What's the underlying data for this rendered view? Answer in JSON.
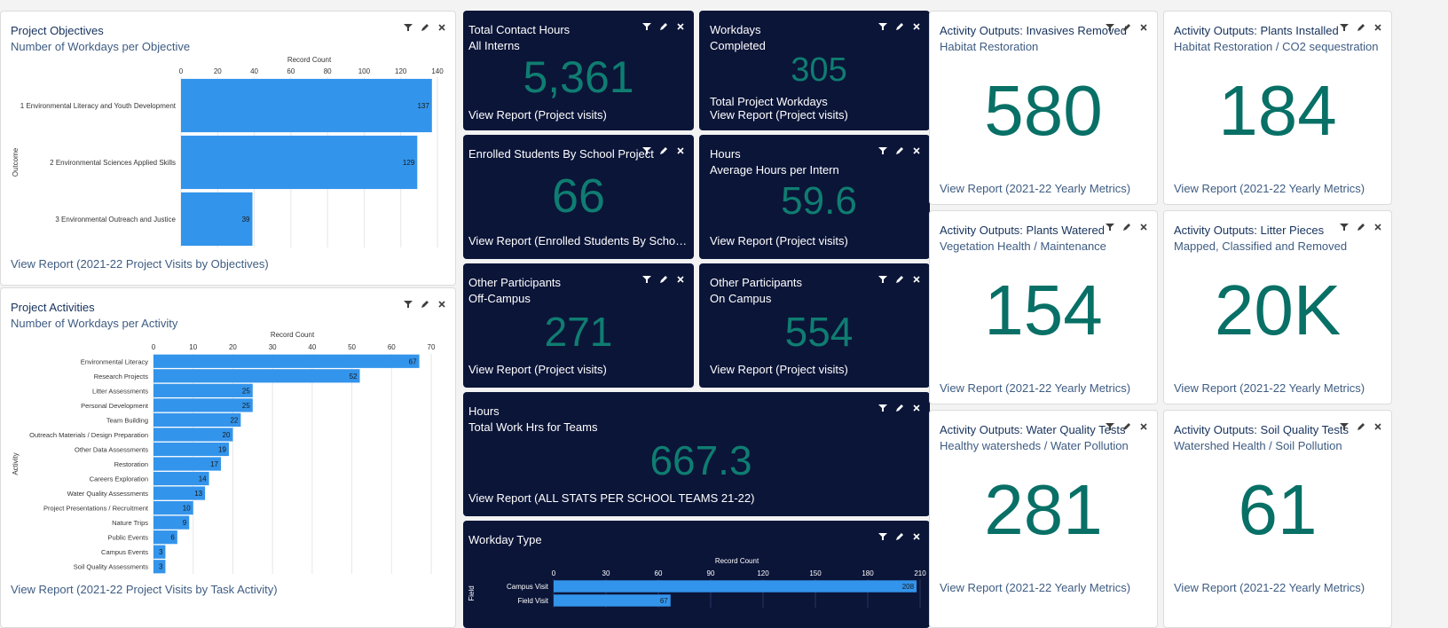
{
  "colors": {
    "accent_teal": "#087066",
    "bar_blue": "#3394eb",
    "dark_panel": "#0b1538",
    "link": "#3e5c82"
  },
  "icons": [
    "filter-icon",
    "pencil-icon",
    "close-icon"
  ],
  "objectives": {
    "title": "Project Objectives",
    "subtitle": "Number of Workdays per Objective",
    "link": "View Report (2021-22 Project Visits by Objectives)",
    "chart_data": {
      "type": "bar",
      "orientation": "horizontal",
      "categories": [
        "1 Environmental Literacy and Youth Development",
        "2 Environmental Sciences Applied Skills",
        "3 Environmental Outreach and Justice"
      ],
      "values": [
        137,
        129,
        39
      ],
      "xlabel": "Record Count",
      "ylabel": "Outcome",
      "xlim": [
        0,
        140
      ],
      "xticks": [
        "0",
        "20",
        "40",
        "60",
        "80",
        "100",
        "120",
        "140"
      ]
    }
  },
  "activities": {
    "title": "Project Activities",
    "subtitle": "Number of Workdays per Activity",
    "link": "View Report (2021-22 Project Visits by Task Activity)",
    "chart_data": {
      "type": "bar",
      "orientation": "horizontal",
      "categories": [
        "Environmental Literacy",
        "Research Projects",
        "Litter Assessments",
        "Personal Development",
        "Team Building",
        "Outreach Materials / Design Preparation",
        "Other Data Assessments",
        "Restoration",
        "Careers Exploration",
        "Water Quality Assessments",
        "Project Presentations / Recruitment",
        "Nature Trips",
        "Public Events",
        "Campus Events",
        "Soil Quality Assessments"
      ],
      "values": [
        67,
        52,
        25,
        25,
        22,
        20,
        19,
        17,
        14,
        13,
        10,
        9,
        6,
        3,
        3
      ],
      "xlabel": "Record Count",
      "ylabel": "Activity",
      "xlim": [
        0,
        70
      ],
      "xticks": [
        "0",
        "10",
        "20",
        "30",
        "40",
        "50",
        "60",
        "70"
      ]
    }
  },
  "dark_metrics": [
    {
      "title": "Total Contact Hours",
      "subtitle": "All Interns",
      "value": "5,361",
      "note": "",
      "link": "View Report (Project visits)"
    },
    {
      "title": "Workdays",
      "subtitle": "Completed",
      "value": "305",
      "note": "Total Project Workdays",
      "link": "View Report (Project visits)"
    },
    {
      "title": "Enrolled Students By School Project",
      "subtitle": "",
      "value": "66",
      "note": "",
      "link": "View Report (Enrolled Students By School Project)"
    },
    {
      "title": "Hours",
      "subtitle": "Average Hours per Intern",
      "value": "59.6",
      "note": "",
      "link": "View Report (Project visits)"
    },
    {
      "title": "Other Participants",
      "subtitle": "Off-Campus",
      "value": "271",
      "note": "",
      "link": "View Report (Project visits)"
    },
    {
      "title": "Other Participants",
      "subtitle": "On Campus",
      "value": "554",
      "note": "",
      "link": "View Report (Project visits)"
    },
    {
      "title": "Hours",
      "subtitle": "Total Work Hrs for Teams",
      "value": "667.3",
      "note": "",
      "link": "View Report (ALL STATS PER SCHOOL TEAMS 21-22)"
    }
  ],
  "workday_type": {
    "title": "Workday Type",
    "chart_data": {
      "type": "bar",
      "orientation": "horizontal",
      "categories": [
        "Campus Visit",
        "Field Visit"
      ],
      "values": [
        208,
        67
      ],
      "xlabel": "Record Count",
      "ylabel": "Field",
      "xlim": [
        0,
        210
      ],
      "xticks": [
        "0",
        "30",
        "60",
        "90",
        "120",
        "150",
        "180",
        "210"
      ]
    }
  },
  "light_metrics": [
    {
      "title": "Activity Outputs: Invasives Removed",
      "subtitle": "Habitat Restoration",
      "value": "580",
      "link": "View Report (2021-22 Yearly Metrics)"
    },
    {
      "title": "Activity Outputs: Plants Installed",
      "subtitle": "Habitat Restoration / CO2 sequestration",
      "value": "184",
      "link": "View Report (2021-22 Yearly Metrics)"
    },
    {
      "title": "Activity Outputs: Plants Watered",
      "subtitle": "Vegetation Health / Maintenance",
      "value": "154",
      "link": "View Report (2021-22 Yearly Metrics)"
    },
    {
      "title": "Activity Outputs: Litter Pieces",
      "subtitle": "Mapped, Classified and Removed",
      "value": "20K",
      "link": "View Report (2021-22 Yearly Metrics)"
    },
    {
      "title": "Activity Outputs: Water Quality Tests",
      "subtitle": "Healthy watersheds / Water Pollution",
      "value": "281",
      "link": "View Report (2021-22 Yearly Metrics)"
    },
    {
      "title": "Activity Outputs: Soil Quality Tests",
      "subtitle": "Watershed Health / Soil Pollution",
      "value": "61",
      "link": "View Report (2021-22 Yearly Metrics)"
    }
  ]
}
